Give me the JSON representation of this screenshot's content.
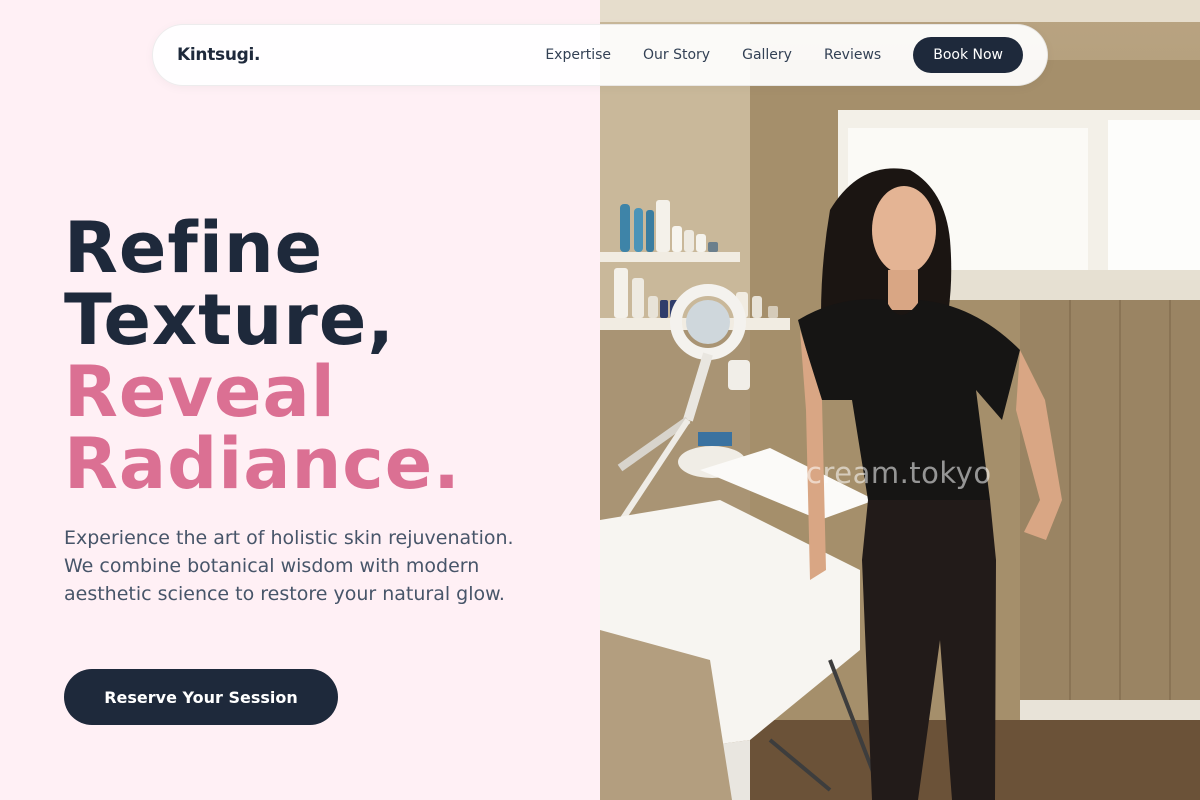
{
  "navbar": {
    "logo": "Kintsugi.",
    "links": [
      "Expertise",
      "Our Story",
      "Gallery",
      "Reviews"
    ],
    "cta": "Book Now"
  },
  "hero": {
    "headline_line1": "Refine",
    "headline_line2": "Texture,",
    "headline_line3": "Reveal",
    "headline_line4": "Radiance.",
    "description": "Experience the art of holistic skin rejuvenation. We combine botanical wisdom with modern aesthetic science to restore your natural glow.",
    "cta": "Reserve Your Session"
  },
  "photo": {
    "watermark": "cream.tokyo"
  },
  "colors": {
    "background": "#fff0f5",
    "navy": "#1e293b",
    "pink": "#db7093",
    "body_text": "#475569"
  }
}
